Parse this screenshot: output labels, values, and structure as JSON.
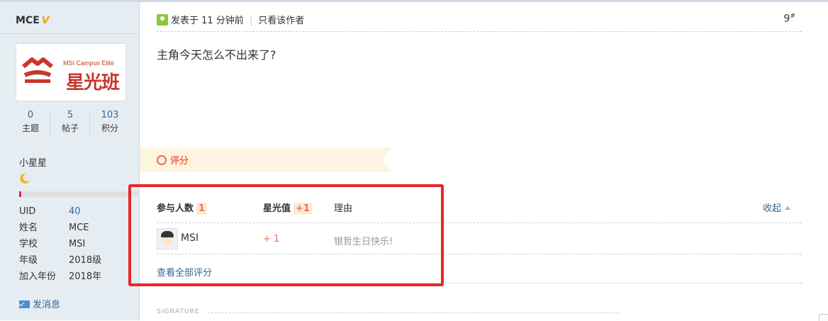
{
  "profile": {
    "username": "MCE",
    "verified_badge": "V",
    "avatar_logo": {
      "en": "MSI Campus Elite",
      "cn": "星光班"
    },
    "stats": [
      {
        "value": "0",
        "label": "主题"
      },
      {
        "value": "5",
        "label": "帖子"
      },
      {
        "value": "103",
        "label": "积分"
      }
    ],
    "rank_title": "小星星",
    "rank_icon": "moon-icon",
    "rank_progress": 0.02,
    "info": [
      {
        "key": "UID",
        "value": "40"
      },
      {
        "key": "姓名",
        "value": "MCE"
      },
      {
        "key": "学校",
        "value": "MSI"
      },
      {
        "key": "年级",
        "value": "2018级"
      },
      {
        "key": "加入年份",
        "value": "2018年"
      }
    ],
    "send_message": "发消息"
  },
  "post": {
    "posted": "发表于 11 分钟前",
    "only_author": "只看该作者",
    "floor": "9",
    "floor_mark": "#",
    "content": "主角今天怎么不出来了?"
  },
  "rating": {
    "title": "评分",
    "headers": {
      "participants": "参与人数",
      "participants_count": "1",
      "star_value": "星光值",
      "star_total": "+1",
      "reason": "理由"
    },
    "collapse": "收起",
    "rows": [
      {
        "user": "MSI",
        "value": "+ 1",
        "reason": "银哲生日快乐!"
      }
    ],
    "view_all": "查看全部评分"
  },
  "signature_label": "SIGNATURE",
  "colors": {
    "accent": "#f26c4f",
    "link": "#336699",
    "highlight_box": "#e8262b",
    "sidebar": "#e5edf2"
  }
}
